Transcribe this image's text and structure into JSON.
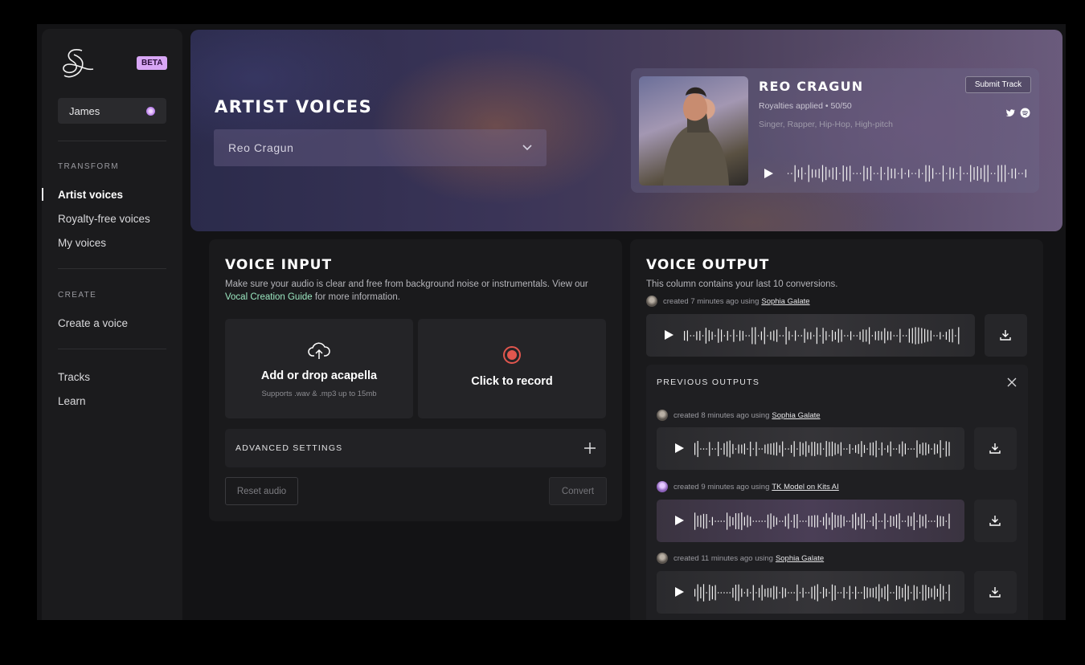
{
  "sidebar": {
    "beta": "BETA",
    "user": "James",
    "sections": {
      "transform": "TRANSFORM",
      "create": "CREATE"
    },
    "transform_items": [
      "Artist voices",
      "Royalty-free voices",
      "My voices"
    ],
    "create_items": [
      "Create a voice"
    ],
    "other_items": [
      "Tracks",
      "Learn"
    ]
  },
  "hero": {
    "title": "ARTIST VOICES",
    "select_value": "Reo Cragun",
    "artist": {
      "name": "REO CRAGUN",
      "royalties": "Royalties applied • 50/50",
      "tags": "Singer, Rapper, Hip-Hop, High-pitch",
      "submit": "Submit Track"
    }
  },
  "input": {
    "title": "VOICE INPUT",
    "desc_before": "Make sure your audio is clear and free from background noise or instrumentals. View our ",
    "desc_link": "Vocal Creation Guide",
    "desc_after": " for more information.",
    "upload_label": "Add or drop acapella",
    "upload_hint": "Supports .wav & .mp3 up to 15mb",
    "record_label": "Click to record",
    "advanced": "ADVANCED SETTINGS",
    "reset": "Reset audio",
    "convert": "Convert"
  },
  "output": {
    "title": "VOICE OUTPUT",
    "desc": "This column contains your last 10 conversions.",
    "latest": {
      "meta": "created 7 minutes ago using",
      "model": "Sophia Galate"
    },
    "previous_title": "PREVIOUS OUTPUTS",
    "previous": [
      {
        "meta": "created 8 minutes ago using",
        "model": "Sophia Galate"
      },
      {
        "meta": "created 9 minutes ago using",
        "model": "TK Model on Kits AI"
      },
      {
        "meta": "created 11 minutes ago using",
        "model": "Sophia Galate"
      }
    ]
  },
  "icons": [
    "logo-icon",
    "user-status-icon",
    "chevron-down-icon",
    "twitter-icon",
    "spotify-icon",
    "play-icon",
    "upload-cloud-icon",
    "record-icon",
    "plus-icon",
    "download-icon",
    "close-icon"
  ],
  "colors": {
    "beta_bg": "#d8a6f5",
    "link": "#9be7c0",
    "record": "#e0564e",
    "background": "#131315"
  }
}
